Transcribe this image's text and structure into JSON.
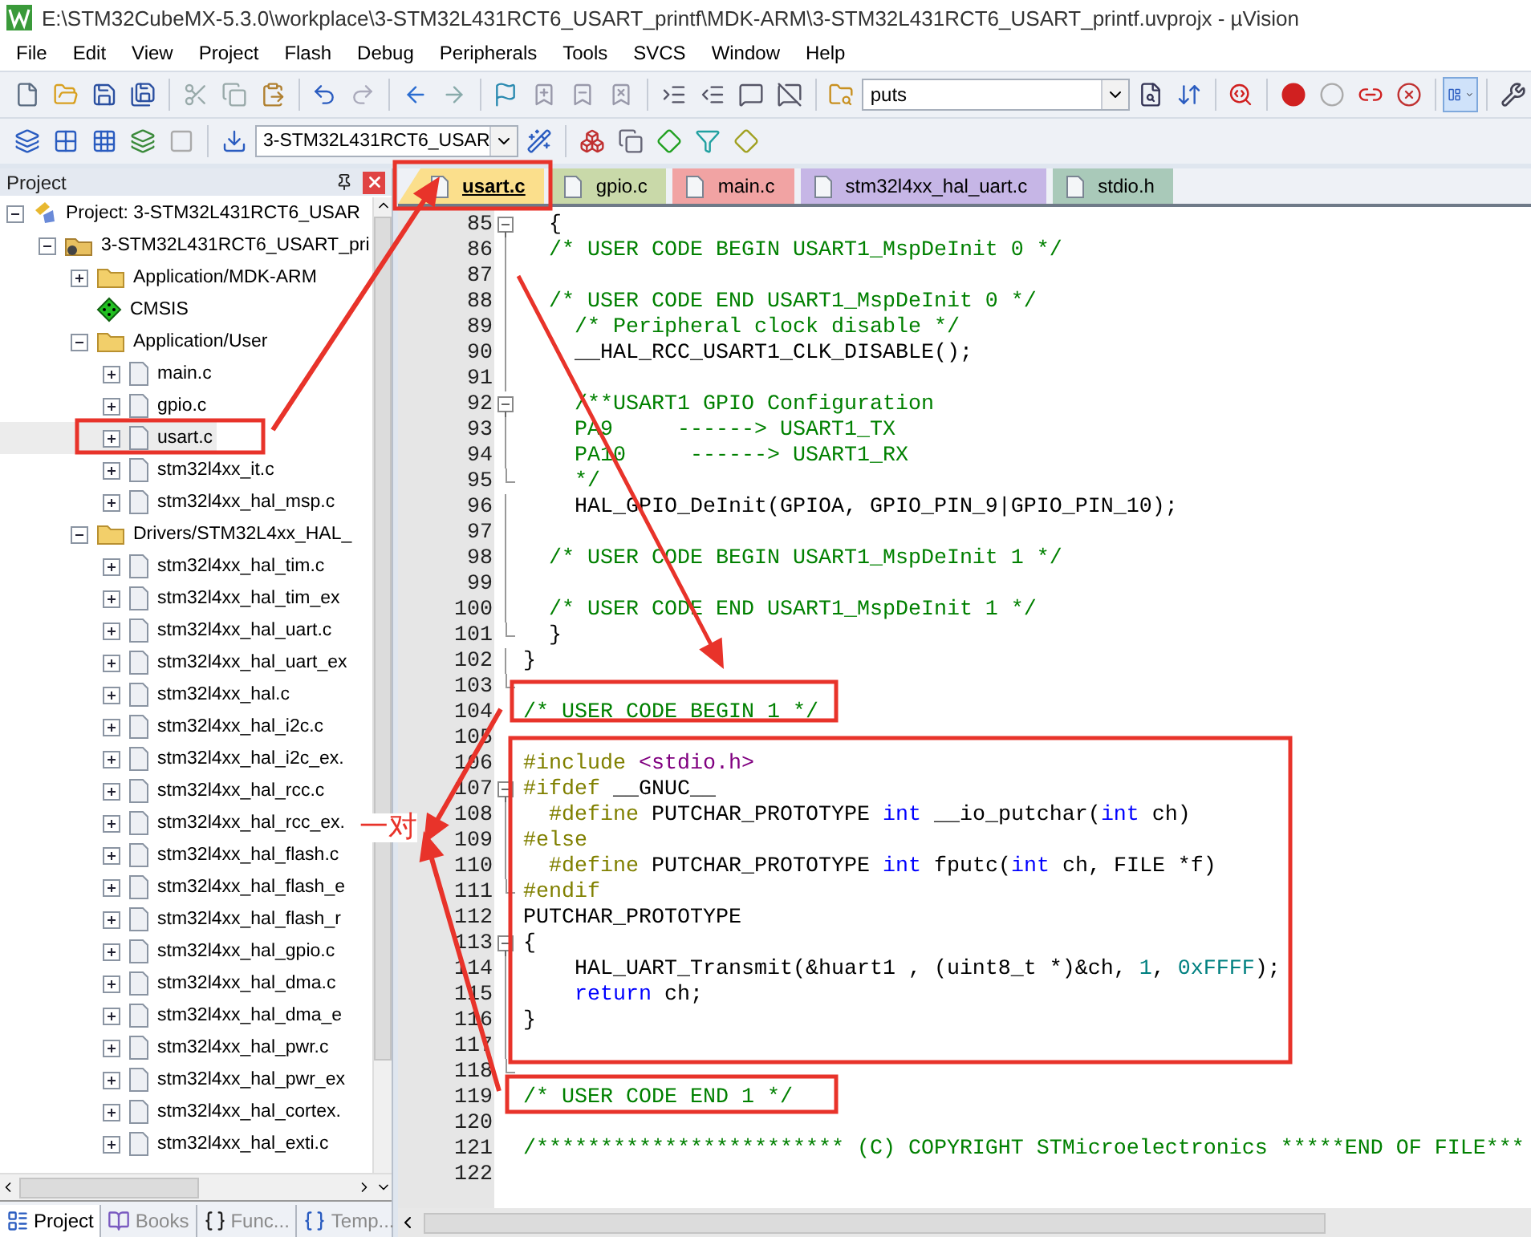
{
  "window": {
    "title": "E:\\STM32CubeMX-5.3.0\\workplace\\3-STM32L431RCT6_USART_printf\\MDK-ARM\\3-STM32L431RCT6_USART_printf.uvprojx - µVision"
  },
  "menu": [
    "File",
    "Edit",
    "View",
    "Project",
    "Flash",
    "Debug",
    "Peripherals",
    "Tools",
    "SVCS",
    "Window",
    "Help"
  ],
  "toolbar": {
    "find_text": "puts",
    "target": "3-STM32L431RCT6_USAR"
  },
  "project_panel": {
    "title": "Project",
    "tree": [
      {
        "kind": "project",
        "label": "Project: 3-STM32L431RCT6_USAR",
        "expanded": true,
        "selected": false,
        "children": [
          {
            "kind": "target",
            "label": "3-STM32L431RCT6_USART_pri",
            "expanded": true,
            "selected": false,
            "children": [
              {
                "kind": "folder",
                "label": "Application/MDK-ARM",
                "expanded": false,
                "selected": false
              },
              {
                "kind": "component",
                "label": "CMSIS",
                "selected": false
              },
              {
                "kind": "folder",
                "label": "Application/User",
                "expanded": true,
                "selected": false,
                "children": [
                  {
                    "kind": "file",
                    "label": "main.c",
                    "expanded": false,
                    "selected": false
                  },
                  {
                    "kind": "file",
                    "label": "gpio.c",
                    "expanded": false,
                    "selected": false
                  },
                  {
                    "kind": "file",
                    "label": "usart.c",
                    "expanded": false,
                    "selected": true
                  },
                  {
                    "kind": "file",
                    "label": "stm32l4xx_it.c",
                    "expanded": false,
                    "selected": false
                  },
                  {
                    "kind": "file",
                    "label": "stm32l4xx_hal_msp.c",
                    "expanded": false,
                    "selected": false
                  }
                ]
              },
              {
                "kind": "folder",
                "label": "Drivers/STM32L4xx_HAL_",
                "expanded": true,
                "selected": false,
                "children": [
                  {
                    "kind": "file",
                    "label": "stm32l4xx_hal_tim.c",
                    "expanded": false,
                    "selected": false
                  },
                  {
                    "kind": "file",
                    "label": "stm32l4xx_hal_tim_ex",
                    "expanded": false,
                    "selected": false
                  },
                  {
                    "kind": "file",
                    "label": "stm32l4xx_hal_uart.c",
                    "expanded": false,
                    "selected": false
                  },
                  {
                    "kind": "file",
                    "label": "stm32l4xx_hal_uart_ex",
                    "expanded": false,
                    "selected": false
                  },
                  {
                    "kind": "file",
                    "label": "stm32l4xx_hal.c",
                    "expanded": false,
                    "selected": false
                  },
                  {
                    "kind": "file",
                    "label": "stm32l4xx_hal_i2c.c",
                    "expanded": false,
                    "selected": false
                  },
                  {
                    "kind": "file",
                    "label": "stm32l4xx_hal_i2c_ex.",
                    "expanded": false,
                    "selected": false
                  },
                  {
                    "kind": "file",
                    "label": "stm32l4xx_hal_rcc.c",
                    "expanded": false,
                    "selected": false
                  },
                  {
                    "kind": "file",
                    "label": "stm32l4xx_hal_rcc_ex.",
                    "expanded": false,
                    "selected": false
                  },
                  {
                    "kind": "file",
                    "label": "stm32l4xx_hal_flash.c",
                    "expanded": false,
                    "selected": false
                  },
                  {
                    "kind": "file",
                    "label": "stm32l4xx_hal_flash_e",
                    "expanded": false,
                    "selected": false
                  },
                  {
                    "kind": "file",
                    "label": "stm32l4xx_hal_flash_r",
                    "expanded": false,
                    "selected": false
                  },
                  {
                    "kind": "file",
                    "label": "stm32l4xx_hal_gpio.c",
                    "expanded": false,
                    "selected": false
                  },
                  {
                    "kind": "file",
                    "label": "stm32l4xx_hal_dma.c",
                    "expanded": false,
                    "selected": false
                  },
                  {
                    "kind": "file",
                    "label": "stm32l4xx_hal_dma_e",
                    "expanded": false,
                    "selected": false
                  },
                  {
                    "kind": "file",
                    "label": "stm32l4xx_hal_pwr.c",
                    "expanded": false,
                    "selected": false
                  },
                  {
                    "kind": "file",
                    "label": "stm32l4xx_hal_pwr_ex",
                    "expanded": false,
                    "selected": false
                  },
                  {
                    "kind": "file",
                    "label": "stm32l4xx_hal_cortex.",
                    "expanded": false,
                    "selected": false
                  },
                  {
                    "kind": "file",
                    "label": "stm32l4xx_hal_exti.c",
                    "expanded": false,
                    "selected": false
                  }
                ]
              }
            ]
          }
        ]
      }
    ],
    "tabs": [
      {
        "kind": "project",
        "label": "Project",
        "selected": true
      },
      {
        "kind": "books",
        "label": "Books",
        "selected": false
      },
      {
        "kind": "functions",
        "label": "Func...",
        "selected": false
      },
      {
        "kind": "templates",
        "label": "Temp...",
        "selected": false
      }
    ]
  },
  "editor": {
    "tabs": [
      {
        "label": "usart.c",
        "selected": true,
        "color": "#fbdf8c"
      },
      {
        "label": "gpio.c",
        "selected": false,
        "color": "#c9d9a9"
      },
      {
        "label": "main.c",
        "selected": false,
        "color": "#f1a3a3"
      },
      {
        "label": "stm32l4xx_hal_uart.c",
        "selected": false,
        "color": "#c6b6e6"
      },
      {
        "label": "stdio.h",
        "selected": false,
        "color": "#a9c9b9"
      }
    ],
    "lines": [
      {
        "number": "85",
        "fold_toggle": true,
        "segments": [
          {
            "kind": "plain",
            "text": "  {"
          }
        ]
      },
      {
        "number": "86",
        "in_fold": true,
        "segments": [
          {
            "kind": "comment",
            "text": "  /* USER CODE BEGIN USART1_MspDeInit 0 */"
          }
        ]
      },
      {
        "number": "87",
        "in_fold": true
      },
      {
        "number": "88",
        "in_fold": true,
        "segments": [
          {
            "kind": "comment",
            "text": "  /* USER CODE END USART1_MspDeInit 0 */"
          }
        ]
      },
      {
        "number": "89",
        "in_fold": true,
        "segments": [
          {
            "kind": "comment",
            "text": "    /* Peripheral clock disable */"
          }
        ]
      },
      {
        "number": "90",
        "in_fold": true,
        "segments": [
          {
            "kind": "plain",
            "text": "    __HAL_RCC_USART1_CLK_DISABLE();"
          }
        ]
      },
      {
        "number": "91",
        "in_fold": true
      },
      {
        "number": "92",
        "fold_toggle": true,
        "segments": [
          {
            "kind": "comment",
            "text": "    /**USART1 GPIO Configuration"
          }
        ]
      },
      {
        "number": "93",
        "in_fold": true,
        "segments": [
          {
            "kind": "comment",
            "text": "    PA9     ------> USART1_TX"
          }
        ]
      },
      {
        "number": "94",
        "in_fold": true,
        "segments": [
          {
            "kind": "comment",
            "text": "    PA10     ------> USART1_RX"
          }
        ]
      },
      {
        "number": "95",
        "fold_end": true,
        "segments": [
          {
            "kind": "comment",
            "text": "    */"
          }
        ]
      },
      {
        "number": "96",
        "in_fold": true,
        "segments": [
          {
            "kind": "plain",
            "text": "    HAL_GPIO_DeInit(GPIOA, GPIO_PIN_9|GPIO_PIN_10);"
          }
        ]
      },
      {
        "number": "97",
        "in_fold": true
      },
      {
        "number": "98",
        "in_fold": true,
        "segments": [
          {
            "kind": "comment",
            "text": "  /* USER CODE BEGIN USART1_MspDeInit 1 */"
          }
        ]
      },
      {
        "number": "99",
        "in_fold": true
      },
      {
        "number": "100",
        "in_fold": true,
        "segments": [
          {
            "kind": "comment",
            "text": "  /* USER CODE END USART1_MspDeInit 1 */"
          }
        ]
      },
      {
        "number": "101",
        "fold_end": true,
        "segments": [
          {
            "kind": "plain",
            "text": "  }"
          }
        ]
      },
      {
        "number": "102",
        "in_fold": true,
        "segments": [
          {
            "kind": "plain",
            "text": "}"
          }
        ]
      },
      {
        "number": "103",
        "fold_end": true
      },
      {
        "number": "104",
        "segments": [
          {
            "kind": "comment",
            "text": "/* USER CODE BEGIN 1 */"
          }
        ]
      },
      {
        "number": "105"
      },
      {
        "number": "106",
        "segments": [
          {
            "kind": "preprocessor",
            "text": "#include"
          },
          {
            "kind": "string",
            "text": " <stdio.h>"
          }
        ]
      },
      {
        "number": "107",
        "fold_toggle": true,
        "segments": [
          {
            "kind": "preprocessor",
            "text": "#ifdef"
          },
          {
            "kind": "plain",
            "text": " __GNUC__"
          }
        ]
      },
      {
        "number": "108",
        "in_fold": true,
        "segments": [
          {
            "kind": "preprocessor",
            "text": "  #define"
          },
          {
            "kind": "plain",
            "text": " PUTCHAR_PROTOTYPE "
          },
          {
            "kind": "keyword",
            "text": "int"
          },
          {
            "kind": "plain",
            "text": " __io_putchar("
          },
          {
            "kind": "keyword",
            "text": "int"
          },
          {
            "kind": "plain",
            "text": " ch)"
          }
        ]
      },
      {
        "number": "109",
        "in_fold": true,
        "segments": [
          {
            "kind": "preprocessor",
            "text": "#else"
          }
        ]
      },
      {
        "number": "110",
        "in_fold": true,
        "segments": [
          {
            "kind": "preprocessor",
            "text": "  #define"
          },
          {
            "kind": "plain",
            "text": " PUTCHAR_PROTOTYPE "
          },
          {
            "kind": "keyword",
            "text": "int"
          },
          {
            "kind": "plain",
            "text": " fputc("
          },
          {
            "kind": "keyword",
            "text": "int"
          },
          {
            "kind": "plain",
            "text": " ch, FILE *f)"
          }
        ]
      },
      {
        "number": "111",
        "fold_end": true,
        "segments": [
          {
            "kind": "preprocessor",
            "text": "#endif"
          }
        ]
      },
      {
        "number": "112",
        "segments": [
          {
            "kind": "plain",
            "text": "PUTCHAR_PROTOTYPE"
          }
        ]
      },
      {
        "number": "113",
        "fold_toggle": true,
        "segments": [
          {
            "kind": "plain",
            "text": "{"
          }
        ]
      },
      {
        "number": "114",
        "in_fold": true,
        "segments": [
          {
            "kind": "plain",
            "text": "    HAL_UART_Transmit(&huart1 , (uint8_t *)&ch, "
          },
          {
            "kind": "number",
            "text": "1"
          },
          {
            "kind": "plain",
            "text": ", "
          },
          {
            "kind": "number",
            "text": "0xFFFF"
          },
          {
            "kind": "plain",
            "text": ");"
          }
        ]
      },
      {
        "number": "115",
        "in_fold": true,
        "segments": [
          {
            "kind": "keyword",
            "text": "    return"
          },
          {
            "kind": "plain",
            "text": " ch;"
          }
        ]
      },
      {
        "number": "116",
        "in_fold": true,
        "segments": [
          {
            "kind": "plain",
            "text": "}"
          }
        ]
      },
      {
        "number": "117",
        "in_fold": true
      },
      {
        "number": "118",
        "fold_end": true
      },
      {
        "number": "119",
        "segments": [
          {
            "kind": "comment",
            "text": "/* USER CODE END 1 */"
          }
        ]
      },
      {
        "number": "120"
      },
      {
        "number": "121",
        "segments": [
          {
            "kind": "comment",
            "text": "/************************ (C) COPYRIGHT STMicroelectronics *****END OF FILE***"
          }
        ]
      },
      {
        "number": "122"
      }
    ]
  },
  "annotation": {
    "label": "一对"
  }
}
